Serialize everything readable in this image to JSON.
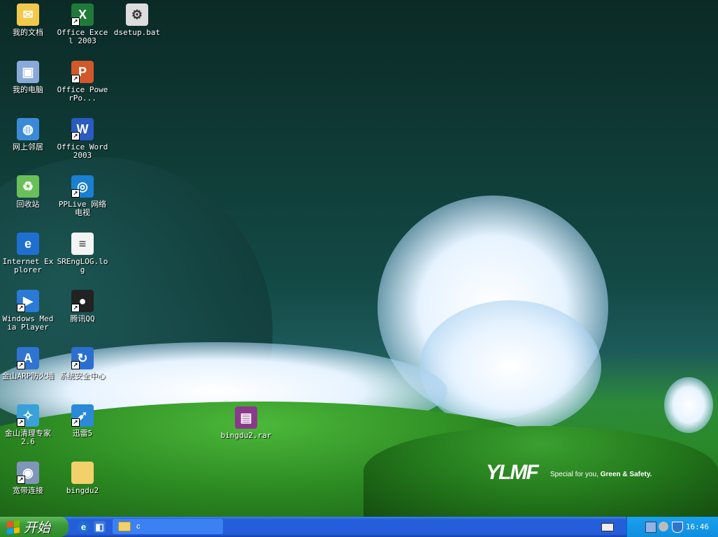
{
  "desktop": {
    "icons": [
      {
        "label": "我的文档",
        "icon": "my-documents-icon",
        "color": "#f2c94c",
        "glyph": "✉",
        "shortcut": false
      },
      {
        "label": "我的电脑",
        "icon": "my-computer-icon",
        "color": "#8aa9d8",
        "glyph": "▣",
        "shortcut": false
      },
      {
        "label": "网上邻居",
        "icon": "network-places-icon",
        "color": "#3a8ad8",
        "glyph": "◍",
        "shortcut": false
      },
      {
        "label": "回收站",
        "icon": "recycle-bin-icon",
        "color": "#6bbf59",
        "glyph": "♻",
        "shortcut": false
      },
      {
        "label": "Internet Explorer",
        "icon": "internet-explorer-icon",
        "color": "#1e6fd0",
        "glyph": "e",
        "shortcut": false
      },
      {
        "label": "Windows Media Player",
        "icon": "media-player-icon",
        "color": "#2a7ad6",
        "glyph": "▶",
        "shortcut": true
      },
      {
        "label": "金山ARP防火墙",
        "icon": "arp-firewall-icon",
        "color": "#2f74d0",
        "glyph": "A",
        "shortcut": true
      },
      {
        "label": "金山清理专家 2.6",
        "icon": "cleaner-icon",
        "color": "#3aa0d8",
        "glyph": "✧",
        "shortcut": true
      },
      {
        "label": "宽带连接",
        "icon": "broadband-icon",
        "color": "#7f96b8",
        "glyph": "◉",
        "shortcut": true
      },
      {
        "label": "Office Excel 2003",
        "icon": "excel-icon",
        "color": "#1f7a3a",
        "glyph": "X",
        "shortcut": true
      },
      {
        "label": "Office PowerPo...",
        "icon": "powerpoint-icon",
        "color": "#d0582a",
        "glyph": "P",
        "shortcut": true
      },
      {
        "label": "Office Word 2003",
        "icon": "word-icon",
        "color": "#2a5bbf",
        "glyph": "W",
        "shortcut": true
      },
      {
        "label": "PPLive 网络电视",
        "icon": "pplive-icon",
        "color": "#1a7fd0",
        "glyph": "◎",
        "shortcut": true
      },
      {
        "label": "SREngLOG.log",
        "icon": "log-file-icon",
        "color": "#f4f4f4",
        "glyph": "≡",
        "shortcut": false
      },
      {
        "label": "腾讯QQ",
        "icon": "qq-icon",
        "color": "#222222",
        "glyph": "●",
        "shortcut": true
      },
      {
        "label": "系统安全中心",
        "icon": "security-center-icon",
        "color": "#2a6fd0",
        "glyph": "↻",
        "shortcut": true
      },
      {
        "label": "迅雷5",
        "icon": "thunder-icon",
        "color": "#2a8ad8",
        "glyph": "➶",
        "shortcut": true
      },
      {
        "label": "bingdu2",
        "icon": "folder-icon",
        "color": "#f2d16b",
        "glyph": "",
        "shortcut": false
      },
      {
        "label": "dsetup.bat",
        "icon": "batch-file-icon",
        "color": "#dddddd",
        "glyph": "⚙",
        "shortcut": false
      },
      {
        "label": "bingdu2.rar",
        "icon": "winrar-archive-icon",
        "color": "#8b3a8b",
        "glyph": "▤",
        "shortcut": false
      }
    ],
    "wallpaper_logo": "YLMF",
    "wallpaper_slogan_prefix": "Special for you, ",
    "wallpaper_slogan_bold": "Green & Safety."
  },
  "taskbar": {
    "start_label": "开始",
    "quick_launch": [
      {
        "name": "internet-explorer-icon",
        "glyph": "e",
        "color": "#1e6fd0"
      },
      {
        "name": "show-desktop-icon",
        "glyph": "◧",
        "color": "#3a7ad8"
      }
    ],
    "tasks": [
      {
        "label": "c"
      }
    ],
    "clock": "16:46"
  }
}
